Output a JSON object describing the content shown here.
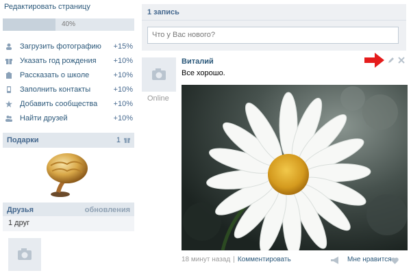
{
  "profile_sidebar": {
    "edit_link": "Редактировать страницу",
    "completion": {
      "label": "40%",
      "value": 0.4
    },
    "tasks": [
      {
        "icon": "user-icon",
        "label": "Загрузить фотографию",
        "bonus": "+15%"
      },
      {
        "icon": "gift-small-icon",
        "label": "Указать год рождения",
        "bonus": "+10%"
      },
      {
        "icon": "school-icon",
        "label": "Рассказать о школе",
        "bonus": "+10%"
      },
      {
        "icon": "phone-icon",
        "label": "Заполнить контакты",
        "bonus": "+10%"
      },
      {
        "icon": "star-icon",
        "label": "Добавить сообщества",
        "bonus": "+10%"
      },
      {
        "icon": "friends-icon",
        "label": "Найти друзей",
        "bonus": "+10%"
      }
    ]
  },
  "gifts": {
    "title": "Подарки",
    "count": "1"
  },
  "friends": {
    "title": "Друзья",
    "updates_link": "обновления",
    "count_text": "1 друг"
  },
  "wall": {
    "title": "1 запись",
    "post_placeholder": "Что у Вас нового?"
  },
  "post": {
    "author": "Виталий",
    "text": "Все хорошо.",
    "status": "Online",
    "time": "18 минут назад",
    "comment_link": "Комментировать",
    "like_label": "Мне нравится"
  },
  "colors": {
    "link": "#2B587A",
    "header_bg": "#e1e7ed",
    "arrow": "#e51c1c"
  }
}
